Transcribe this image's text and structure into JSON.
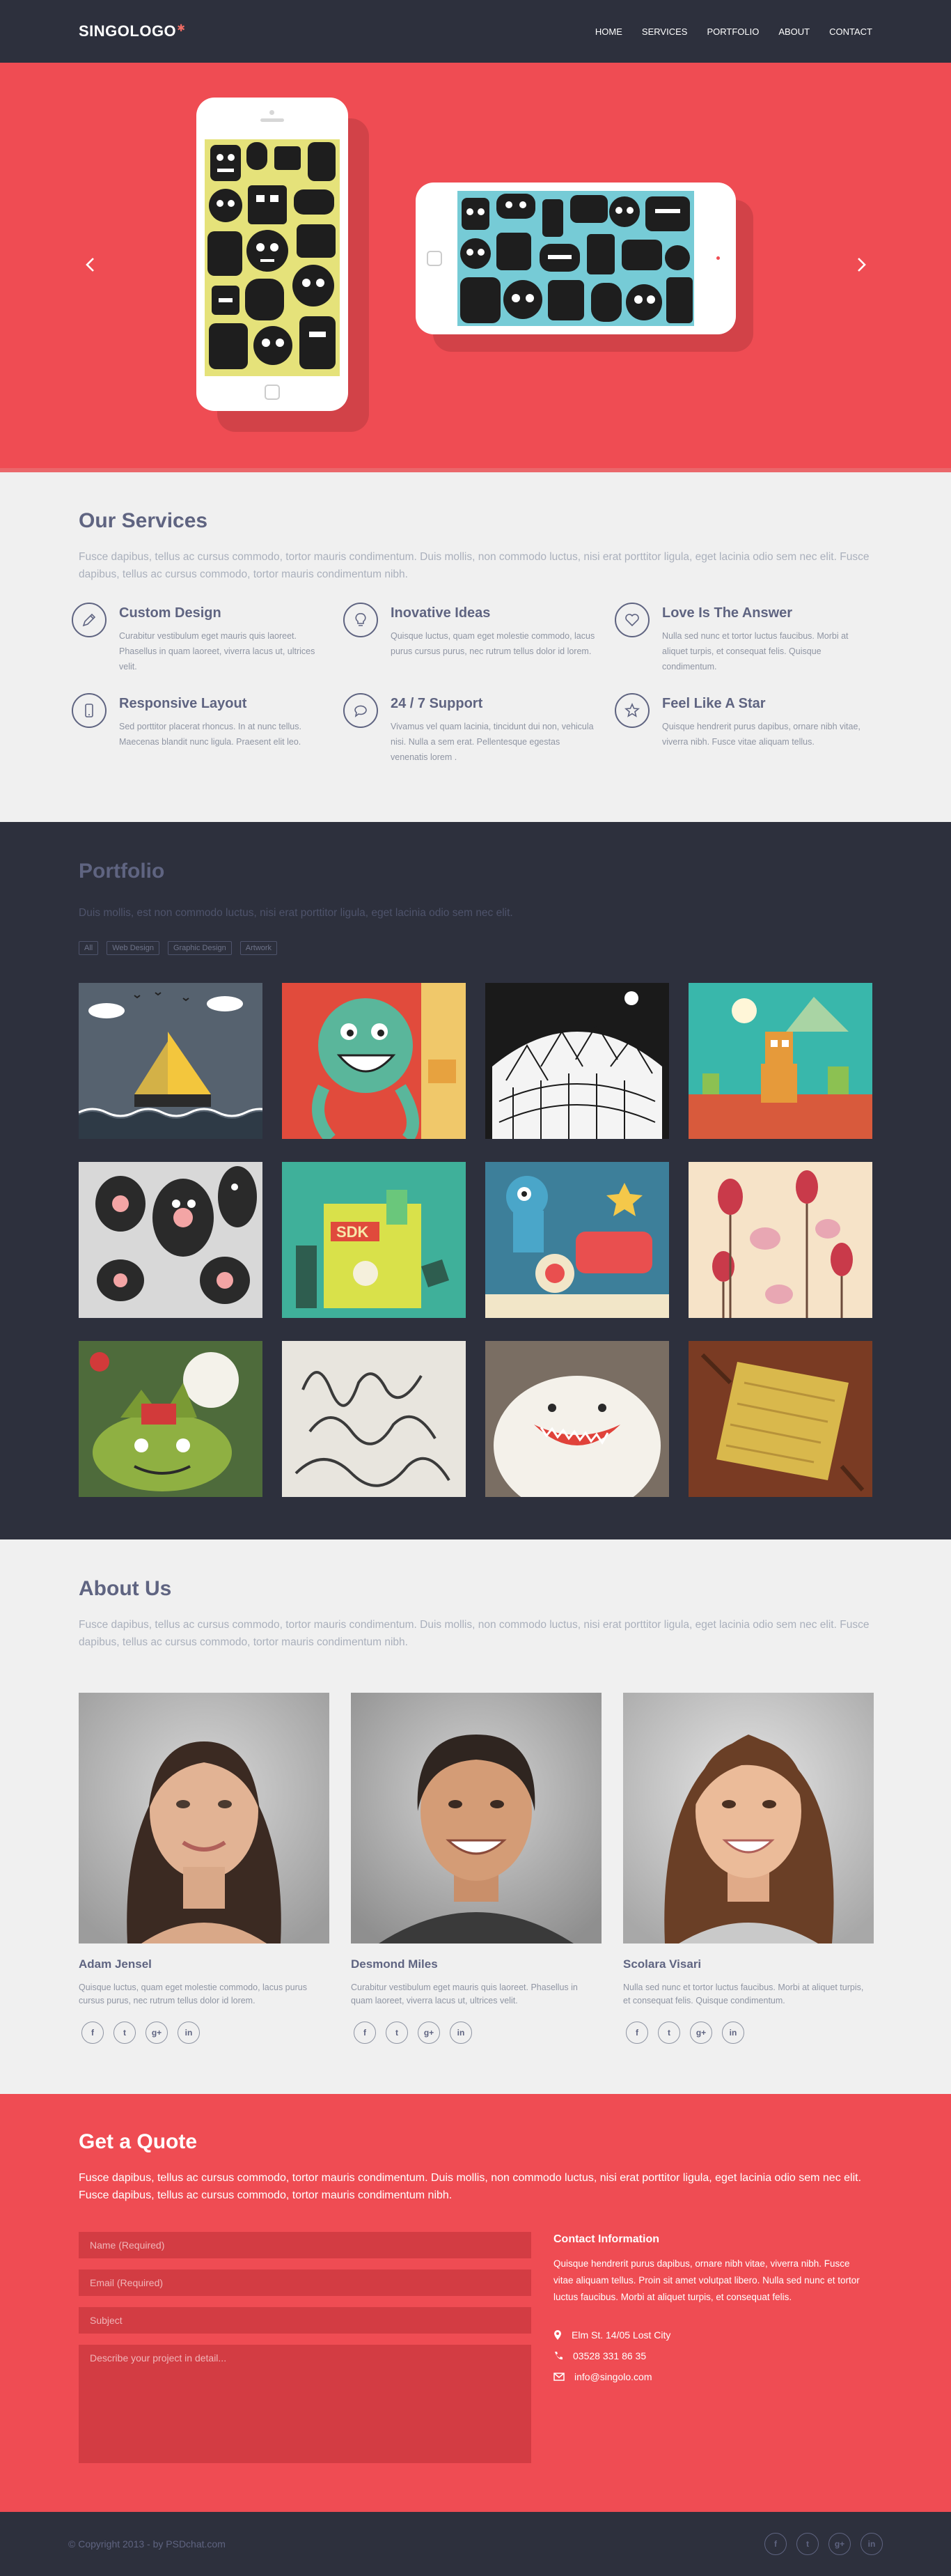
{
  "header": {
    "logo": "SINGOLOGO",
    "nav": [
      "HOME",
      "SERVICES",
      "PORTFOLIO",
      "ABOUT",
      "CONTACT"
    ]
  },
  "slider": {
    "prev_icon": "chevron-left-icon",
    "next_icon": "chevron-right-icon"
  },
  "services": {
    "title": "Our Services",
    "desc": "Fusce dapibus, tellus ac cursus commodo, tortor mauris condimentum. Duis mollis, non commodo luctus, nisi erat porttitor ligula, eget lacinia odio sem nec elit. Fusce dapibus, tellus ac cursus commodo, tortor mauris condimentum nibh.",
    "items": [
      {
        "title": "Custom Design",
        "icon": "pencil-icon",
        "text": "Curabitur vestibulum eget mauris quis laoreet. Phasellus in quam laoreet, viverra lacus ut, ultrices velit."
      },
      {
        "title": "Inovative Ideas",
        "icon": "lightbulb-icon",
        "text": "Quisque luctus, quam eget molestie commodo, lacus purus cursus purus, nec rutrum tellus dolor id lorem."
      },
      {
        "title": "Love Is The Answer",
        "icon": "heart-icon",
        "text": "Nulla sed nunc et tortor luctus faucibus. Morbi at aliquet turpis, et consequat felis. Quisque condimentum."
      },
      {
        "title": "Responsive Layout",
        "icon": "phone-icon",
        "text": "Sed porttitor placerat rhoncus. In at nunc tellus. Maecenas blandit nunc ligula. Praesent elit leo."
      },
      {
        "title": "24 / 7 Support",
        "icon": "chat-icon",
        "text": "Vivamus vel quam lacinia, tincidunt dui non, vehicula nisi. Nulla a sem erat. Pellentesque egestas venenatis lorem ."
      },
      {
        "title": "Feel Like A Star",
        "icon": "star-icon",
        "text": "Quisque hendrerit purus dapibus, ornare nibh vitae, viverra nibh. Fusce vitae aliquam tellus."
      }
    ]
  },
  "portfolio": {
    "title": "Portfolio",
    "desc": "Duis mollis, est non commodo luctus, nisi erat porttitor ligula, eget lacinia odio sem nec elit.",
    "filters": [
      "All",
      "Web Design",
      "Graphic Design",
      "Artwork"
    ]
  },
  "about": {
    "title": "About Us",
    "desc": "Fusce dapibus, tellus ac cursus commodo, tortor mauris condimentum. Duis mollis, non commodo luctus, nisi erat porttitor ligula, eget lacinia odio sem nec elit. Fusce dapibus, tellus ac cursus commodo, tortor mauris condimentum nibh.",
    "members": [
      {
        "name": "Adam Jensel",
        "text": "Quisque luctus, quam eget molestie commodo, lacus purus cursus purus, nec rutrum tellus dolor id lorem."
      },
      {
        "name": "Desmond Miles",
        "text": "Curabitur vestibulum eget mauris quis laoreet. Phasellus in quam laoreet, viverra lacus ut, ultrices velit."
      },
      {
        "name": "Scolara Visari",
        "text": "Nulla sed nunc et tortor luctus faucibus. Morbi at aliquet turpis, et consequat felis. Quisque condimentum."
      }
    ],
    "social": [
      "f",
      "t",
      "g+",
      "in"
    ]
  },
  "quote": {
    "title": "Get a Quote",
    "desc": "Fusce dapibus, tellus ac cursus commodo, tortor mauris condimentum. Duis mollis, non commodo luctus, nisi erat porttitor ligula, eget lacinia odio sem nec elit. Fusce dapibus, tellus ac cursus commodo, tortor mauris condimentum nibh.",
    "fields": {
      "name": "Name (Required)",
      "email": "Email (Required)",
      "subject": "Subject",
      "message": "Describe your project in detail..."
    },
    "contact_title": "Contact Information",
    "contact_text": "Quisque hendrerit purus dapibus, ornare nibh vitae, viverra nibh. Fusce vitae aliquam tellus. Proin sit amet volutpat libero. Nulla sed nunc et tortor luctus faucibus. Morbi at aliquet turpis, et consequat felis.",
    "address": "Elm St. 14/05 Lost City",
    "phone": "03528 331 86 35",
    "email": "info@singolo.com"
  },
  "footer": {
    "copyright": "© Copyright 2013 - by PSDchat.com"
  }
}
